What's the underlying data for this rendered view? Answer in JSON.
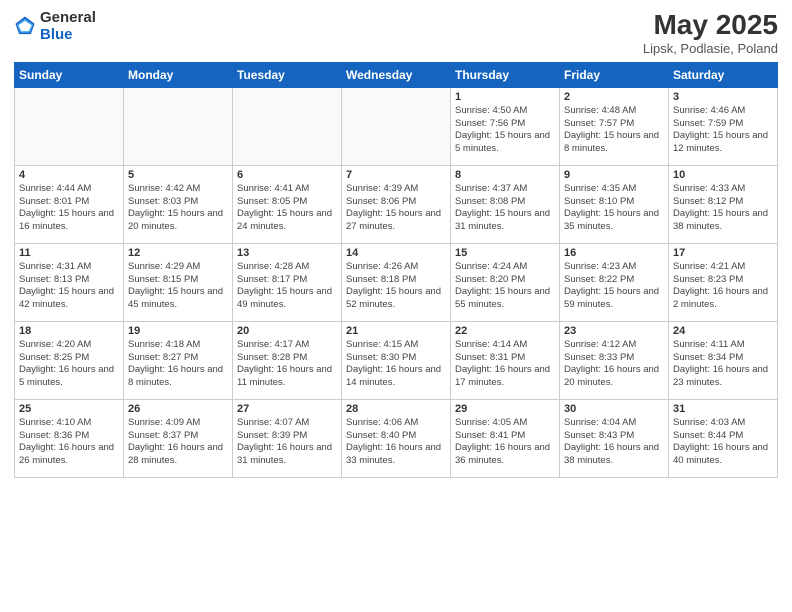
{
  "logo": {
    "general": "General",
    "blue": "Blue"
  },
  "title": "May 2025",
  "subtitle": "Lipsk, Podlasie, Poland",
  "days_header": [
    "Sunday",
    "Monday",
    "Tuesday",
    "Wednesday",
    "Thursday",
    "Friday",
    "Saturday"
  ],
  "weeks": [
    [
      {
        "day": "",
        "info": ""
      },
      {
        "day": "",
        "info": ""
      },
      {
        "day": "",
        "info": ""
      },
      {
        "day": "",
        "info": ""
      },
      {
        "day": "1",
        "info": "Sunrise: 4:50 AM\nSunset: 7:56 PM\nDaylight: 15 hours\nand 5 minutes."
      },
      {
        "day": "2",
        "info": "Sunrise: 4:48 AM\nSunset: 7:57 PM\nDaylight: 15 hours\nand 8 minutes."
      },
      {
        "day": "3",
        "info": "Sunrise: 4:46 AM\nSunset: 7:59 PM\nDaylight: 15 hours\nand 12 minutes."
      }
    ],
    [
      {
        "day": "4",
        "info": "Sunrise: 4:44 AM\nSunset: 8:01 PM\nDaylight: 15 hours\nand 16 minutes."
      },
      {
        "day": "5",
        "info": "Sunrise: 4:42 AM\nSunset: 8:03 PM\nDaylight: 15 hours\nand 20 minutes."
      },
      {
        "day": "6",
        "info": "Sunrise: 4:41 AM\nSunset: 8:05 PM\nDaylight: 15 hours\nand 24 minutes."
      },
      {
        "day": "7",
        "info": "Sunrise: 4:39 AM\nSunset: 8:06 PM\nDaylight: 15 hours\nand 27 minutes."
      },
      {
        "day": "8",
        "info": "Sunrise: 4:37 AM\nSunset: 8:08 PM\nDaylight: 15 hours\nand 31 minutes."
      },
      {
        "day": "9",
        "info": "Sunrise: 4:35 AM\nSunset: 8:10 PM\nDaylight: 15 hours\nand 35 minutes."
      },
      {
        "day": "10",
        "info": "Sunrise: 4:33 AM\nSunset: 8:12 PM\nDaylight: 15 hours\nand 38 minutes."
      }
    ],
    [
      {
        "day": "11",
        "info": "Sunrise: 4:31 AM\nSunset: 8:13 PM\nDaylight: 15 hours\nand 42 minutes."
      },
      {
        "day": "12",
        "info": "Sunrise: 4:29 AM\nSunset: 8:15 PM\nDaylight: 15 hours\nand 45 minutes."
      },
      {
        "day": "13",
        "info": "Sunrise: 4:28 AM\nSunset: 8:17 PM\nDaylight: 15 hours\nand 49 minutes."
      },
      {
        "day": "14",
        "info": "Sunrise: 4:26 AM\nSunset: 8:18 PM\nDaylight: 15 hours\nand 52 minutes."
      },
      {
        "day": "15",
        "info": "Sunrise: 4:24 AM\nSunset: 8:20 PM\nDaylight: 15 hours\nand 55 minutes."
      },
      {
        "day": "16",
        "info": "Sunrise: 4:23 AM\nSunset: 8:22 PM\nDaylight: 15 hours\nand 59 minutes."
      },
      {
        "day": "17",
        "info": "Sunrise: 4:21 AM\nSunset: 8:23 PM\nDaylight: 16 hours\nand 2 minutes."
      }
    ],
    [
      {
        "day": "18",
        "info": "Sunrise: 4:20 AM\nSunset: 8:25 PM\nDaylight: 16 hours\nand 5 minutes."
      },
      {
        "day": "19",
        "info": "Sunrise: 4:18 AM\nSunset: 8:27 PM\nDaylight: 16 hours\nand 8 minutes."
      },
      {
        "day": "20",
        "info": "Sunrise: 4:17 AM\nSunset: 8:28 PM\nDaylight: 16 hours\nand 11 minutes."
      },
      {
        "day": "21",
        "info": "Sunrise: 4:15 AM\nSunset: 8:30 PM\nDaylight: 16 hours\nand 14 minutes."
      },
      {
        "day": "22",
        "info": "Sunrise: 4:14 AM\nSunset: 8:31 PM\nDaylight: 16 hours\nand 17 minutes."
      },
      {
        "day": "23",
        "info": "Sunrise: 4:12 AM\nSunset: 8:33 PM\nDaylight: 16 hours\nand 20 minutes."
      },
      {
        "day": "24",
        "info": "Sunrise: 4:11 AM\nSunset: 8:34 PM\nDaylight: 16 hours\nand 23 minutes."
      }
    ],
    [
      {
        "day": "25",
        "info": "Sunrise: 4:10 AM\nSunset: 8:36 PM\nDaylight: 16 hours\nand 26 minutes."
      },
      {
        "day": "26",
        "info": "Sunrise: 4:09 AM\nSunset: 8:37 PM\nDaylight: 16 hours\nand 28 minutes."
      },
      {
        "day": "27",
        "info": "Sunrise: 4:07 AM\nSunset: 8:39 PM\nDaylight: 16 hours\nand 31 minutes."
      },
      {
        "day": "28",
        "info": "Sunrise: 4:06 AM\nSunset: 8:40 PM\nDaylight: 16 hours\nand 33 minutes."
      },
      {
        "day": "29",
        "info": "Sunrise: 4:05 AM\nSunset: 8:41 PM\nDaylight: 16 hours\nand 36 minutes."
      },
      {
        "day": "30",
        "info": "Sunrise: 4:04 AM\nSunset: 8:43 PM\nDaylight: 16 hours\nand 38 minutes."
      },
      {
        "day": "31",
        "info": "Sunrise: 4:03 AM\nSunset: 8:44 PM\nDaylight: 16 hours\nand 40 minutes."
      }
    ]
  ]
}
